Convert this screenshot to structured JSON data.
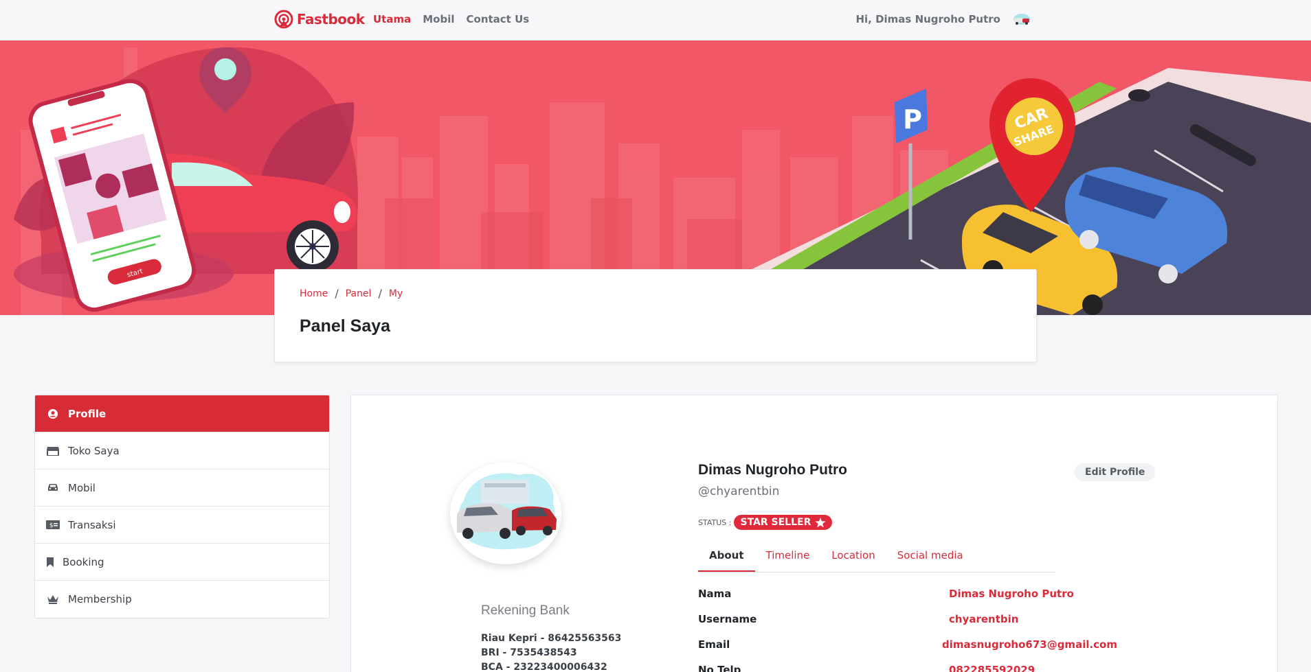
{
  "navbar": {
    "brand": "Fastbook",
    "links": [
      "Utama",
      "Mobil",
      "Contact Us"
    ],
    "greeting": "Hi, Dimas Nugroho Putro"
  },
  "hero": {
    "parking_sign": "P",
    "pin_text_1": "CAR",
    "pin_text_2": "SHARE",
    "phone_button": "start"
  },
  "breadcrumb": [
    "Home",
    "Panel",
    "My"
  ],
  "page_title": "Panel Saya",
  "sidebar": [
    {
      "label": "Profile",
      "icon": "user-circle-icon",
      "active": true
    },
    {
      "label": "Toko Saya",
      "icon": "store-icon"
    },
    {
      "label": "Mobil",
      "icon": "car-icon"
    },
    {
      "label": "Transaksi",
      "icon": "money-bill-icon"
    },
    {
      "label": "Booking",
      "icon": "bookmark-icon"
    },
    {
      "label": "Membership",
      "icon": "crown-icon"
    }
  ],
  "profile": {
    "name": "Dimas Nugroho Putro",
    "username": "@chyarentbin",
    "edit_label": "Edit Profile",
    "status_label": "STATUS :",
    "status_badge": "STAR SELLER",
    "bank_title": "Rekening Bank",
    "banks": [
      "Riau Kepri - 86425563563",
      "BRI - 7535438543",
      "BCA - 23223400006432"
    ]
  },
  "tabs": [
    "About",
    "Timeline",
    "Location",
    "Social media"
  ],
  "about": [
    {
      "key": "Nama",
      "value": "Dimas Nugroho Putro"
    },
    {
      "key": "Username",
      "value": "chyarentbin"
    },
    {
      "key": "Email",
      "value": "dimasnugroho673@gmail.com"
    },
    {
      "key": "No Telp",
      "value": "082285592029"
    }
  ],
  "colors": {
    "primary": "#d92b3a",
    "hero": "#f25767"
  }
}
